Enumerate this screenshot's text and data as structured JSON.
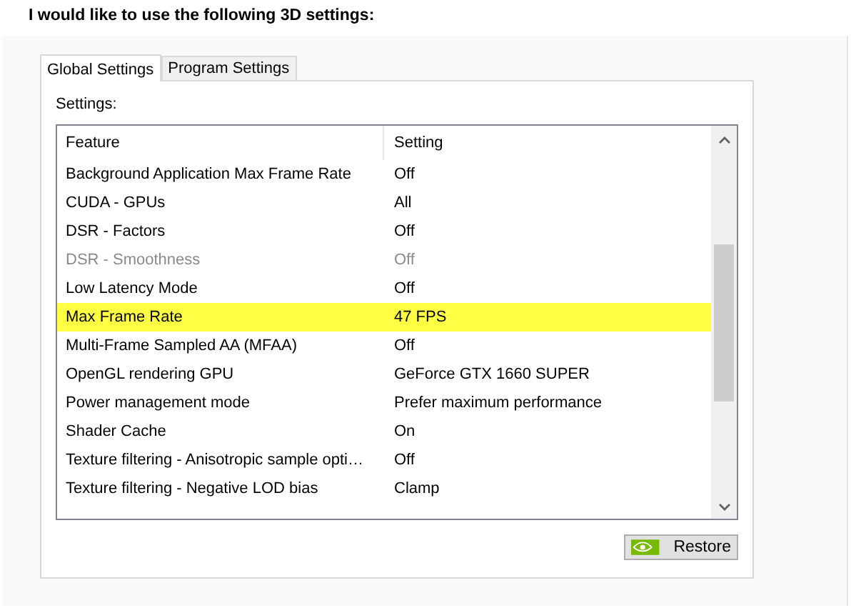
{
  "heading": "I would like to use the following 3D settings:",
  "tabs": [
    {
      "label": "Global Settings",
      "selected": true
    },
    {
      "label": "Program Settings",
      "selected": false
    }
  ],
  "settings_label": "Settings:",
  "table": {
    "columns": [
      "Feature",
      "Setting"
    ],
    "rows": [
      {
        "feature": "Background Application Max Frame Rate",
        "setting": "Off",
        "disabled": false,
        "highlighted": false
      },
      {
        "feature": "CUDA - GPUs",
        "setting": "All",
        "disabled": false,
        "highlighted": false
      },
      {
        "feature": "DSR - Factors",
        "setting": "Off",
        "disabled": false,
        "highlighted": false
      },
      {
        "feature": "DSR - Smoothness",
        "setting": "Off",
        "disabled": true,
        "highlighted": false
      },
      {
        "feature": "Low Latency Mode",
        "setting": "Off",
        "disabled": false,
        "highlighted": false
      },
      {
        "feature": "Max Frame Rate",
        "setting": "47 FPS",
        "disabled": false,
        "highlighted": true
      },
      {
        "feature": "Multi-Frame Sampled AA (MFAA)",
        "setting": "Off",
        "disabled": false,
        "highlighted": false
      },
      {
        "feature": "OpenGL rendering GPU",
        "setting": "GeForce GTX 1660 SUPER",
        "disabled": false,
        "highlighted": false
      },
      {
        "feature": "Power management mode",
        "setting": "Prefer maximum performance",
        "disabled": false,
        "highlighted": false
      },
      {
        "feature": "Shader Cache",
        "setting": "On",
        "disabled": false,
        "highlighted": false
      },
      {
        "feature": "Texture filtering - Anisotropic sample opti…",
        "setting": "Off",
        "disabled": false,
        "highlighted": false
      },
      {
        "feature": "Texture filtering - Negative LOD bias",
        "setting": "Clamp",
        "disabled": false,
        "highlighted": false
      }
    ]
  },
  "restore_button": "Restore"
}
